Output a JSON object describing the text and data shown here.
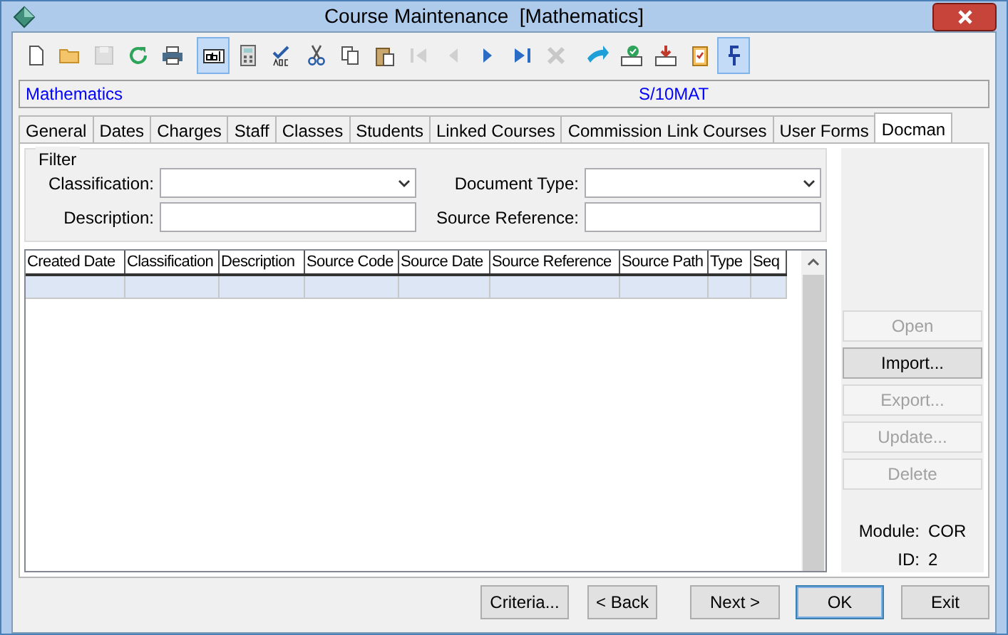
{
  "window": {
    "title": "Course Maintenance  [Mathematics]"
  },
  "toolbar": [
    {
      "kind": "button",
      "disabled": false
    },
    {
      "kind": "button",
      "disabled": false
    },
    {
      "kind": "button",
      "disabled": true
    },
    {
      "kind": "button",
      "disabled": false
    },
    {
      "kind": "button",
      "disabled": false
    },
    {
      "kind": "toggle",
      "disabled": false,
      "pressed": true
    },
    {
      "kind": "button",
      "disabled": false
    },
    {
      "kind": "button",
      "disabled": false
    },
    {
      "kind": "button",
      "disabled": false
    },
    {
      "kind": "button",
      "disabled": false
    },
    {
      "kind": "button",
      "disabled": false
    },
    {
      "kind": "button",
      "disabled": true
    },
    {
      "kind": "button",
      "disabled": true
    },
    {
      "kind": "button",
      "disabled": false
    },
    {
      "kind": "button",
      "disabled": false
    },
    {
      "kind": "button",
      "disabled": true
    },
    {
      "kind": "button",
      "disabled": false
    },
    {
      "kind": "button",
      "disabled": false
    },
    {
      "kind": "button",
      "disabled": false
    },
    {
      "kind": "button",
      "disabled": false
    },
    {
      "kind": "toggle",
      "disabled": false,
      "pressed": true
    }
  ],
  "header": {
    "name": "Mathematics",
    "code": "S/10MAT"
  },
  "tabs": [
    {
      "label": "General",
      "selected": false
    },
    {
      "label": "Dates",
      "selected": false
    },
    {
      "label": "Charges",
      "selected": false
    },
    {
      "label": "Staff",
      "selected": false
    },
    {
      "label": "Classes",
      "selected": false
    },
    {
      "label": "Students",
      "selected": false
    },
    {
      "label": "Linked Courses",
      "selected": false
    },
    {
      "label": "Commission Link Courses",
      "selected": false
    },
    {
      "label": "User Forms",
      "selected": false
    },
    {
      "label": "Docman",
      "selected": true
    }
  ],
  "filter": {
    "title": "Filter",
    "fields": [
      {
        "kind": "select",
        "label": "Classification:"
      },
      {
        "kind": "select",
        "label": "Document Type:"
      },
      {
        "kind": "text",
        "label": "Description:"
      },
      {
        "kind": "text",
        "label": "Source Reference:"
      }
    ]
  },
  "table": {
    "columns": [
      "Created Date",
      "Classification",
      "Description",
      "Source Code",
      "Source Date",
      "Source Reference",
      "Source Path",
      "Type",
      "Seq"
    ],
    "rows": [
      {
        "selected": true
      }
    ]
  },
  "actions": [
    {
      "label": "Open",
      "disabled": true
    },
    {
      "label": "Import...",
      "disabled": false
    },
    {
      "label": "Export...",
      "disabled": true
    },
    {
      "label": "Update...",
      "disabled": true
    },
    {
      "label": "Delete",
      "disabled": true
    }
  ],
  "info": [
    {
      "label": "Module:",
      "value": "COR"
    },
    {
      "label": "ID:",
      "value": "2"
    }
  ],
  "buttons": [
    {
      "label": "Criteria...",
      "default": false
    },
    {
      "label": "< Back",
      "default": false
    },
    {
      "label": "Next >",
      "default": false
    },
    {
      "label": "OK",
      "default": true
    },
    {
      "label": "Exit",
      "default": false
    }
  ]
}
